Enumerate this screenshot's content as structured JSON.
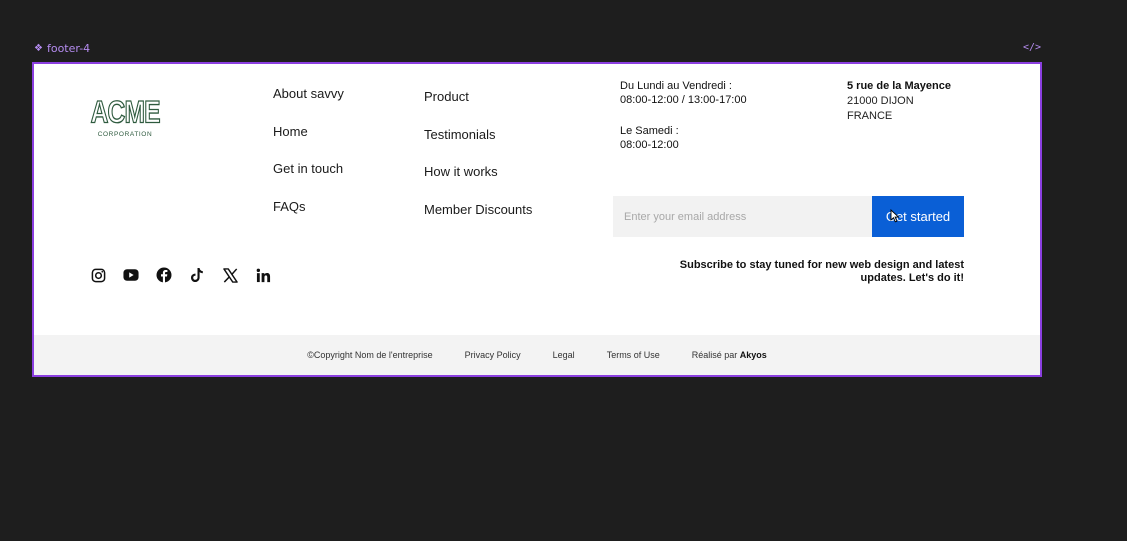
{
  "canvas": {
    "frame_label": "footer-4",
    "code_toggle": "</>"
  },
  "logo": {
    "word": "ACME",
    "sub": "CORPORATION",
    "color": "#2e5a3e"
  },
  "nav": {
    "col1": [
      "About savvy",
      "Home",
      "Get in touch",
      "FAQs"
    ],
    "col2": [
      "Product",
      "Testimonials",
      "How it works",
      "Member Discounts"
    ]
  },
  "hours": {
    "weekday_label": "Du Lundi au Vendredi :",
    "weekday_time": "08:00-12:00 / 13:00-17:00",
    "saturday_label": "Le Samedi :",
    "saturday_time": "08:00-12:00"
  },
  "address": {
    "street": "5 rue de la Mayence",
    "city": "21000 DIJON",
    "country": "FRANCE"
  },
  "subscribe": {
    "placeholder": "Enter your email address",
    "button_label": "Get started",
    "button_color": "#0a5fd6",
    "tagline": "Subscribe to stay tuned for new web design and latest updates. Let's do it!"
  },
  "socials": [
    "instagram-icon",
    "youtube-icon",
    "facebook-icon",
    "tiktok-icon",
    "x-icon",
    "linkedin-icon"
  ],
  "bottom": {
    "copyright": "©Copyright Nom de l'entreprise",
    "privacy": "Privacy Policy",
    "legal": "Legal",
    "terms": "Terms of Use",
    "credit_prefix": "Réalisé par ",
    "credit_name": "Akyos"
  },
  "colors": {
    "frame_border": "#8b3fe0",
    "canvas_bg": "#1e1e1e",
    "bottom_bar_bg": "#f3f3f3"
  }
}
